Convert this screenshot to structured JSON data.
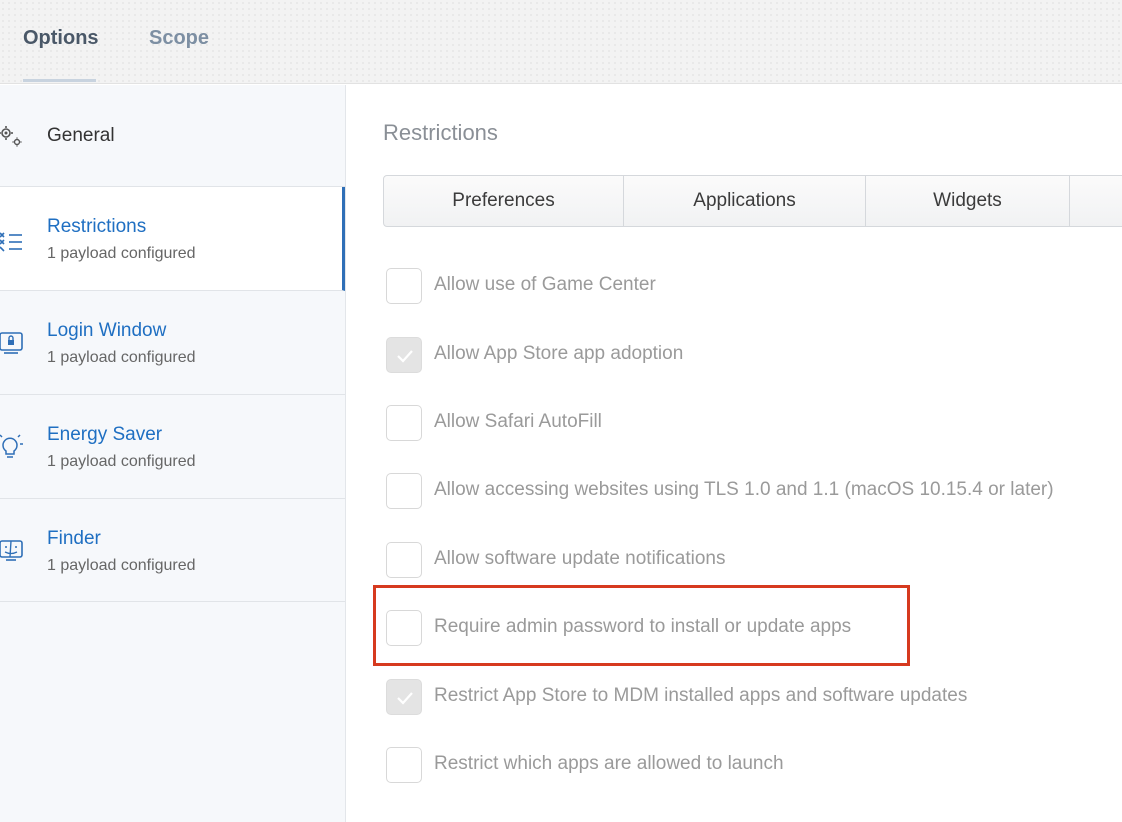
{
  "tabs": [
    {
      "label": "Options",
      "active": true
    },
    {
      "label": "Scope",
      "active": false
    }
  ],
  "sidebar": {
    "items": [
      {
        "icon": "gear-icon",
        "title": "General",
        "subtitle": ""
      },
      {
        "icon": "restrictions-list-icon",
        "title": "Restrictions",
        "subtitle": "1 payload configured"
      },
      {
        "icon": "login-window-icon",
        "title": "Login Window",
        "subtitle": "1 payload configured"
      },
      {
        "icon": "lightbulb-icon",
        "title": "Energy Saver",
        "subtitle": "1 payload configured"
      },
      {
        "icon": "finder-icon",
        "title": "Finder",
        "subtitle": "1 payload configured"
      }
    ]
  },
  "main": {
    "section_title": "Restrictions",
    "segments": [
      "Preferences",
      "Applications",
      "Widgets"
    ],
    "selected_segment": "Applications",
    "options": [
      {
        "label": "Allow use of Game Center",
        "checked": false
      },
      {
        "label": "Allow App Store app adoption",
        "checked": true
      },
      {
        "label": "Allow Safari AutoFill",
        "checked": false
      },
      {
        "label": "Allow accessing websites using TLS 1.0 and 1.1 (macOS 10.15.4 or later)",
        "checked": false
      },
      {
        "label": "Allow software update notifications",
        "checked": false
      },
      {
        "label": "Require admin password to install or update apps",
        "checked": false
      },
      {
        "label": "Restrict App Store to MDM installed apps and software updates",
        "checked": true
      },
      {
        "label": "Restrict which apps are allowed to launch",
        "checked": false
      }
    ]
  },
  "colors": {
    "accent": "#1f6fc2",
    "highlight": "#d63a1f"
  }
}
